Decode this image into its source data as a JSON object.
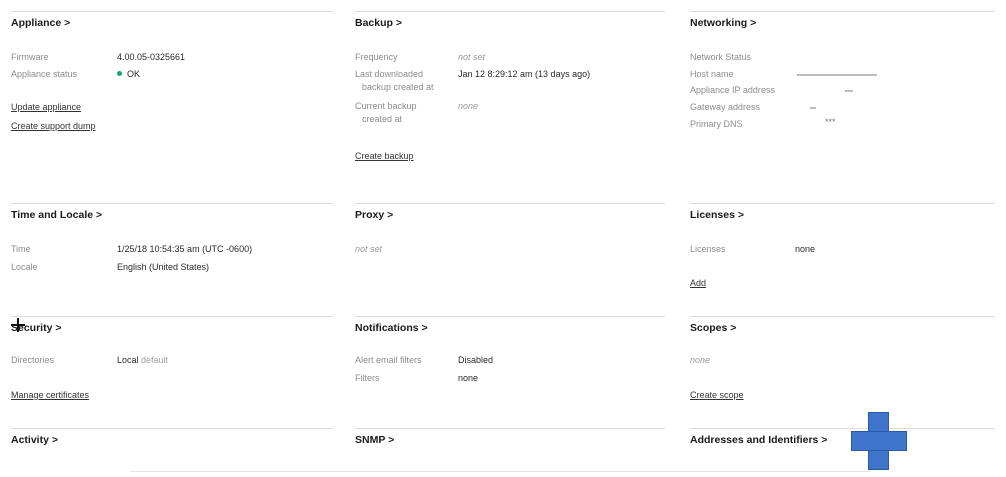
{
  "appliance": {
    "title": "Appliance >",
    "firmware_label": "Firmware",
    "firmware_value": "4.00.05-0325661",
    "status_label": "Appliance status",
    "status_value": "OK",
    "update_link": "Update appliance",
    "support_link": "Create support dump"
  },
  "backup": {
    "title": "Backup >",
    "frequency_label": "Frequency",
    "frequency_value": "not set",
    "last_label_1": "Last downloaded",
    "last_label_2": "backup created at",
    "last_value": "Jan 12 8:29:12 am (13 days ago)",
    "current_label_1": "Current backup",
    "current_label_2": "created at",
    "current_value": "none",
    "create_link": "Create backup"
  },
  "networking": {
    "title": "Networking >",
    "status_label": "Network Status",
    "host_label": "Host name",
    "ip_label": "Appliance IP address",
    "gateway_label": "Gateway address",
    "dns_label": "Primary DNS",
    "dns_value": "***"
  },
  "time_locale": {
    "title": "Time and Locale >",
    "time_label": "Time",
    "time_value": "1/25/18 10:54:35 am (UTC -0600)",
    "locale_label": "Locale",
    "locale_value": "English (United States)"
  },
  "proxy": {
    "title": "Proxy >",
    "value": "not set"
  },
  "licenses": {
    "title": "Licenses >",
    "label": "Licenses",
    "value": "none",
    "add_link": "Add"
  },
  "security": {
    "title": "Security >",
    "directories_label": "Directories",
    "directories_value": "Local",
    "directories_suffix": "default",
    "certs_link": "Manage certificates"
  },
  "notifications": {
    "title": "Notifications >",
    "alert_label": "Alert email filters",
    "alert_value": "Disabled",
    "filters_label": "Filters",
    "filters_value": "none"
  },
  "scopes": {
    "title": "Scopes >",
    "value": "none",
    "create_link": "Create scope"
  },
  "activity": {
    "title": "Activity >"
  },
  "snmp": {
    "title": "SNMP >"
  },
  "addresses": {
    "title": "Addresses and Identifiers >"
  },
  "colors": {
    "status_ok": "#1aa37a",
    "annotation_cross": "#3e74c9"
  }
}
